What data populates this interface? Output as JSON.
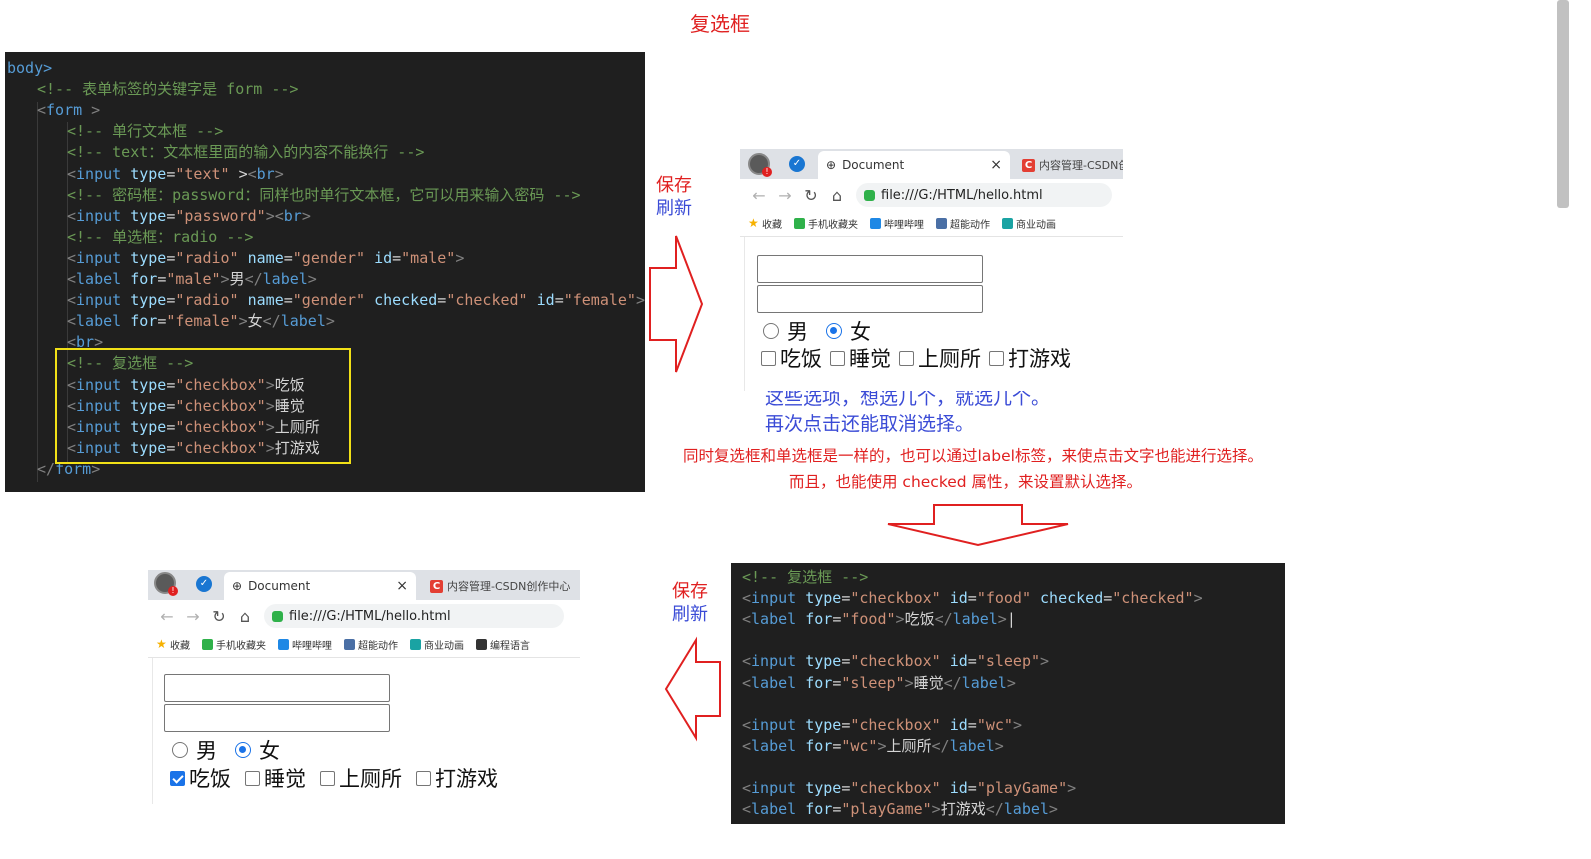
{
  "title": "复选框",
  "code_top": {
    "lines": [
      {
        "indent": 0,
        "parts": [
          [
            "tag",
            "body>"
          ]
        ]
      },
      {
        "indent": 1,
        "parts": [
          [
            "comment",
            "<!-- 表单标签的关键字是 form -->"
          ]
        ]
      },
      {
        "indent": 1,
        "parts": [
          [
            "punct",
            "<"
          ],
          [
            "tag",
            "form"
          ],
          [
            "punct",
            " >"
          ]
        ]
      },
      {
        "indent": 2,
        "parts": [
          [
            "comment",
            "<!-- 单行文本框 -->"
          ]
        ]
      },
      {
        "indent": 2,
        "parts": [
          [
            "comment",
            "<!-- text：文本框里面的输入的内容不能换行 -->"
          ]
        ]
      },
      {
        "indent": 2,
        "parts": [
          [
            "punct",
            "<"
          ],
          [
            "tag",
            "input"
          ],
          [
            "text",
            " "
          ],
          [
            "attr",
            "type"
          ],
          [
            "text",
            "="
          ],
          [
            "str",
            "\"text\""
          ],
          [
            "text",
            " >"
          ],
          [
            "punct",
            "<"
          ],
          [
            "tag",
            "br"
          ],
          [
            "punct",
            ">"
          ]
        ]
      },
      {
        "indent": 2,
        "parts": [
          [
            "comment",
            "<!-- 密码框：password：同样也时单行文本框，它可以用来输入密码 -->"
          ]
        ]
      },
      {
        "indent": 2,
        "parts": [
          [
            "punct",
            "<"
          ],
          [
            "tag",
            "input"
          ],
          [
            "text",
            " "
          ],
          [
            "attr",
            "type"
          ],
          [
            "text",
            "="
          ],
          [
            "str",
            "\"password\""
          ],
          [
            "punct",
            ">"
          ],
          [
            "punct",
            "<"
          ],
          [
            "tag",
            "br"
          ],
          [
            "punct",
            ">"
          ]
        ]
      },
      {
        "indent": 2,
        "parts": [
          [
            "comment",
            "<!-- 单选框：radio -->"
          ]
        ]
      },
      {
        "indent": 2,
        "parts": [
          [
            "punct",
            "<"
          ],
          [
            "tag",
            "input"
          ],
          [
            "text",
            " "
          ],
          [
            "attr",
            "type"
          ],
          [
            "text",
            "="
          ],
          [
            "str",
            "\"radio\""
          ],
          [
            "text",
            " "
          ],
          [
            "attr",
            "name"
          ],
          [
            "text",
            "="
          ],
          [
            "str",
            "\"gender\""
          ],
          [
            "text",
            " "
          ],
          [
            "attr",
            "id"
          ],
          [
            "text",
            "="
          ],
          [
            "str",
            "\"male\""
          ],
          [
            "punct",
            ">"
          ]
        ]
      },
      {
        "indent": 2,
        "parts": [
          [
            "punct",
            "<"
          ],
          [
            "tag",
            "label"
          ],
          [
            "text",
            " "
          ],
          [
            "attr",
            "for"
          ],
          [
            "text",
            "="
          ],
          [
            "str",
            "\"male\""
          ],
          [
            "punct",
            ">"
          ],
          [
            "text",
            "男"
          ],
          [
            "punct",
            "</"
          ],
          [
            "tag",
            "label"
          ],
          [
            "punct",
            ">"
          ]
        ]
      },
      {
        "indent": 2,
        "parts": [
          [
            "punct",
            "<"
          ],
          [
            "tag",
            "input"
          ],
          [
            "text",
            " "
          ],
          [
            "attr",
            "type"
          ],
          [
            "text",
            "="
          ],
          [
            "str",
            "\"radio\""
          ],
          [
            "text",
            " "
          ],
          [
            "attr",
            "name"
          ],
          [
            "text",
            "="
          ],
          [
            "str",
            "\"gender\""
          ],
          [
            "text",
            " "
          ],
          [
            "attr",
            "checked"
          ],
          [
            "text",
            "="
          ],
          [
            "str",
            "\"checked\""
          ],
          [
            "text",
            " "
          ],
          [
            "attr",
            "id"
          ],
          [
            "text",
            "="
          ],
          [
            "str",
            "\"female\""
          ],
          [
            "punct",
            ">"
          ]
        ]
      },
      {
        "indent": 2,
        "parts": [
          [
            "punct",
            "<"
          ],
          [
            "tag",
            "label"
          ],
          [
            "text",
            " "
          ],
          [
            "attr",
            "for"
          ],
          [
            "text",
            "="
          ],
          [
            "str",
            "\"female\""
          ],
          [
            "punct",
            ">"
          ],
          [
            "text",
            "女"
          ],
          [
            "punct",
            "</"
          ],
          [
            "tag",
            "label"
          ],
          [
            "punct",
            ">"
          ]
        ]
      },
      {
        "indent": 2,
        "parts": [
          [
            "punct",
            "<"
          ],
          [
            "tag",
            "br"
          ],
          [
            "punct",
            ">"
          ]
        ]
      },
      {
        "indent": 2,
        "parts": [
          [
            "comment",
            "<!-- 复选框 -->"
          ]
        ]
      },
      {
        "indent": 2,
        "parts": [
          [
            "punct",
            "<"
          ],
          [
            "tag",
            "input"
          ],
          [
            "text",
            " "
          ],
          [
            "attr",
            "type"
          ],
          [
            "text",
            "="
          ],
          [
            "str",
            "\"checkbox\""
          ],
          [
            "punct",
            ">"
          ],
          [
            "text",
            "吃饭"
          ]
        ]
      },
      {
        "indent": 2,
        "parts": [
          [
            "punct",
            "<"
          ],
          [
            "tag",
            "input"
          ],
          [
            "text",
            " "
          ],
          [
            "attr",
            "type"
          ],
          [
            "text",
            "="
          ],
          [
            "str",
            "\"checkbox\""
          ],
          [
            "punct",
            ">"
          ],
          [
            "text",
            "睡觉"
          ]
        ]
      },
      {
        "indent": 2,
        "parts": [
          [
            "punct",
            "<"
          ],
          [
            "tag",
            "input"
          ],
          [
            "text",
            " "
          ],
          [
            "attr",
            "type"
          ],
          [
            "text",
            "="
          ],
          [
            "str",
            "\"checkbox\""
          ],
          [
            "punct",
            ">"
          ],
          [
            "text",
            "上厕所"
          ]
        ]
      },
      {
        "indent": 2,
        "parts": [
          [
            "punct",
            "<"
          ],
          [
            "tag",
            "input"
          ],
          [
            "text",
            " "
          ],
          [
            "attr",
            "type"
          ],
          [
            "text",
            "="
          ],
          [
            "str",
            "\"checkbox\""
          ],
          [
            "punct",
            ">"
          ],
          [
            "text",
            "打游戏"
          ]
        ]
      },
      {
        "indent": 1,
        "parts": [
          [
            "punct",
            "</"
          ],
          [
            "tag",
            "form"
          ],
          [
            "punct",
            ">"
          ]
        ]
      }
    ]
  },
  "code_bottom": {
    "lines": [
      {
        "indent": 0,
        "parts": [
          [
            "comment",
            "<!-- 复选框 -->"
          ]
        ]
      },
      {
        "indent": 0,
        "parts": [
          [
            "punct",
            "<"
          ],
          [
            "tag",
            "input"
          ],
          [
            "text",
            " "
          ],
          [
            "attr",
            "type"
          ],
          [
            "text",
            "="
          ],
          [
            "str",
            "\"checkbox\""
          ],
          [
            "text",
            " "
          ],
          [
            "attr",
            "id"
          ],
          [
            "text",
            "="
          ],
          [
            "str",
            "\"food\""
          ],
          [
            "text",
            " "
          ],
          [
            "attr",
            "checked"
          ],
          [
            "text",
            "="
          ],
          [
            "str",
            "\"checked\""
          ],
          [
            "punct",
            ">"
          ]
        ]
      },
      {
        "indent": 0,
        "parts": [
          [
            "punct",
            "<"
          ],
          [
            "tag",
            "label"
          ],
          [
            "text",
            " "
          ],
          [
            "attr",
            "for"
          ],
          [
            "text",
            "="
          ],
          [
            "str",
            "\"food\""
          ],
          [
            "punct",
            ">"
          ],
          [
            "text",
            "吃饭"
          ],
          [
            "punct",
            "</"
          ],
          [
            "tag",
            "label"
          ],
          [
            "punct",
            ">"
          ],
          [
            "text",
            "|"
          ]
        ]
      },
      {
        "indent": 0,
        "parts": []
      },
      {
        "indent": 0,
        "parts": [
          [
            "punct",
            "<"
          ],
          [
            "tag",
            "input"
          ],
          [
            "text",
            " "
          ],
          [
            "attr",
            "type"
          ],
          [
            "text",
            "="
          ],
          [
            "str",
            "\"checkbox\""
          ],
          [
            "text",
            " "
          ],
          [
            "attr",
            "id"
          ],
          [
            "text",
            "="
          ],
          [
            "str",
            "\"sleep\""
          ],
          [
            "punct",
            ">"
          ]
        ]
      },
      {
        "indent": 0,
        "parts": [
          [
            "punct",
            "<"
          ],
          [
            "tag",
            "label"
          ],
          [
            "text",
            " "
          ],
          [
            "attr",
            "for"
          ],
          [
            "text",
            "="
          ],
          [
            "str",
            "\"sleep\""
          ],
          [
            "punct",
            ">"
          ],
          [
            "text",
            "睡觉"
          ],
          [
            "punct",
            "</"
          ],
          [
            "tag",
            "label"
          ],
          [
            "punct",
            ">"
          ]
        ]
      },
      {
        "indent": 0,
        "parts": []
      },
      {
        "indent": 0,
        "parts": [
          [
            "punct",
            "<"
          ],
          [
            "tag",
            "input"
          ],
          [
            "text",
            " "
          ],
          [
            "attr",
            "type"
          ],
          [
            "text",
            "="
          ],
          [
            "str",
            "\"checkbox\""
          ],
          [
            "text",
            " "
          ],
          [
            "attr",
            "id"
          ],
          [
            "text",
            "="
          ],
          [
            "str",
            "\"wc\""
          ],
          [
            "punct",
            ">"
          ]
        ]
      },
      {
        "indent": 0,
        "parts": [
          [
            "punct",
            "<"
          ],
          [
            "tag",
            "label"
          ],
          [
            "text",
            " "
          ],
          [
            "attr",
            "for"
          ],
          [
            "text",
            "="
          ],
          [
            "str",
            "\"wc\""
          ],
          [
            "punct",
            ">"
          ],
          [
            "text",
            "上厕所"
          ],
          [
            "punct",
            "</"
          ],
          [
            "tag",
            "label"
          ],
          [
            "punct",
            ">"
          ]
        ]
      },
      {
        "indent": 0,
        "parts": []
      },
      {
        "indent": 0,
        "parts": [
          [
            "punct",
            "<"
          ],
          [
            "tag",
            "input"
          ],
          [
            "text",
            " "
          ],
          [
            "attr",
            "type"
          ],
          [
            "text",
            "="
          ],
          [
            "str",
            "\"checkbox\""
          ],
          [
            "text",
            " "
          ],
          [
            "attr",
            "id"
          ],
          [
            "text",
            "="
          ],
          [
            "str",
            "\"playGame\""
          ],
          [
            "punct",
            ">"
          ]
        ]
      },
      {
        "indent": 0,
        "parts": [
          [
            "punct",
            "<"
          ],
          [
            "tag",
            "label"
          ],
          [
            "text",
            " "
          ],
          [
            "attr",
            "for"
          ],
          [
            "text",
            "="
          ],
          [
            "str",
            "\"playGame\""
          ],
          [
            "punct",
            ">"
          ],
          [
            "text",
            "打游戏"
          ],
          [
            "punct",
            "</"
          ],
          [
            "tag",
            "label"
          ],
          [
            "punct",
            ">"
          ]
        ]
      }
    ]
  },
  "save_refresh": {
    "line1": "保存",
    "line2": "刷新"
  },
  "notes": {
    "blue1": "这些选项，想选几个，就选几个。",
    "blue2": "再次点击还能取消选择。",
    "red1": "同时复选框和单选框是一样的，也可以通过label标签，来使点击文字也能进行选择。",
    "red2": "而且，也能使用 checked 属性，来设置默认选择。"
  },
  "browser": {
    "tab_title": "Document",
    "tab_close": "×",
    "tab_other_top": "内容管理-CSDN创",
    "tab_other_bottom": "内容管理-CSDN创作中心",
    "url": "file:///G:/HTML/hello.html",
    "bookmarks_top": [
      "收藏",
      "手机收藏夹",
      "哔哩哔哩",
      "超能动作",
      "商业动画"
    ],
    "bookmarks_bottom": [
      "收藏",
      "手机收藏夹",
      "哔哩哔哩",
      "超能动作",
      "商业动画",
      "编程语言"
    ],
    "radio_male": "男",
    "radio_female": "女",
    "checkboxes": [
      "吃饭",
      "睡觉",
      "上厕所",
      "打游戏"
    ]
  },
  "form_state_top": {
    "female_checked": true,
    "checked": [
      false,
      false,
      false,
      false
    ]
  },
  "form_state_bottom": {
    "female_checked": true,
    "checked": [
      true,
      false,
      false,
      false
    ]
  },
  "colors": {
    "annotation_red": "#e02020",
    "annotation_blue": "#3a4bd6",
    "highlight": "#f1e017",
    "code_bg": "#1f1f1f"
  }
}
